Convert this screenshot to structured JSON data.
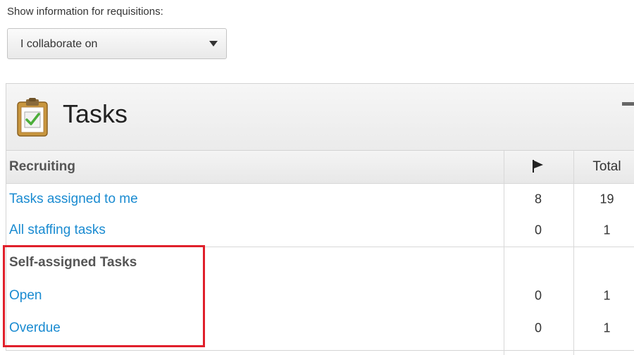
{
  "filter": {
    "label": "Show information for requisitions:",
    "selected": "I collaborate on"
  },
  "panel": {
    "title": "Tasks",
    "icon": "clipboard-check-icon",
    "columns": {
      "flag": "flag-icon",
      "total": "Total"
    },
    "groups": [
      {
        "header": "Recruiting",
        "rows": [
          {
            "label": "Tasks assigned to me",
            "flag": "8",
            "total": "19"
          },
          {
            "label": "All staffing tasks",
            "flag": "0",
            "total": "1"
          }
        ]
      },
      {
        "header": "Self-assigned Tasks",
        "rows": [
          {
            "label": "Open",
            "flag": "0",
            "total": "1"
          },
          {
            "label": "Overdue",
            "flag": "0",
            "total": "1"
          }
        ]
      }
    ]
  },
  "colors": {
    "link": "#1a8bd1",
    "highlight": "#e0202b",
    "icon_clipboard": "#c8963e",
    "icon_check": "#4cae3a"
  }
}
